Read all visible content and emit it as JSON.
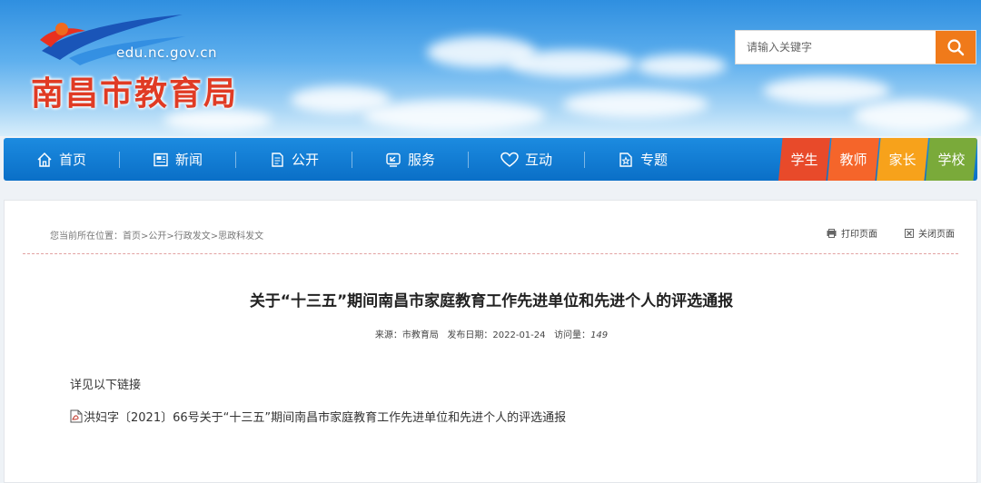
{
  "header": {
    "logo_url": "edu.nc.gov.cn",
    "logo_title": "南昌市教育局",
    "search": {
      "placeholder": "请输入关键字",
      "icon": "search-icon"
    }
  },
  "nav": {
    "items": [
      {
        "label": "首页",
        "icon": "home-icon"
      },
      {
        "label": "新闻",
        "icon": "news-icon"
      },
      {
        "label": "公开",
        "icon": "document-icon"
      },
      {
        "label": "服务",
        "icon": "service-icon"
      },
      {
        "label": "互动",
        "icon": "heart-icon"
      },
      {
        "label": "专题",
        "icon": "topic-icon"
      }
    ],
    "roles": [
      {
        "label": "学生",
        "color": "#e84a2a"
      },
      {
        "label": "教师",
        "color": "#f5652a"
      },
      {
        "label": "家长",
        "color": "#f7a21b"
      },
      {
        "label": "学校",
        "color": "#7aaa3a"
      }
    ]
  },
  "breadcrumb": {
    "prefix": "您当前所在位置：",
    "items": [
      "首页",
      "公开",
      "行政发文",
      "思政科发文"
    ],
    "separator": ">"
  },
  "tools": {
    "print": "打印页面",
    "close": "关闭页面"
  },
  "article": {
    "title": "关于“十三五”期间南昌市家庭教育工作先进单位和先进个人的评选通报",
    "source_label": "来源：",
    "source": "市教育局",
    "date_label": "发布日期：",
    "date": "2022-01-24",
    "views_label": "访问量：",
    "views": "149",
    "body": "详见以下链接",
    "attachment": "洪妇字〔2021〕66号关于“十三五”期间南昌市家庭教育工作先进单位和先进个人的评选通报"
  }
}
